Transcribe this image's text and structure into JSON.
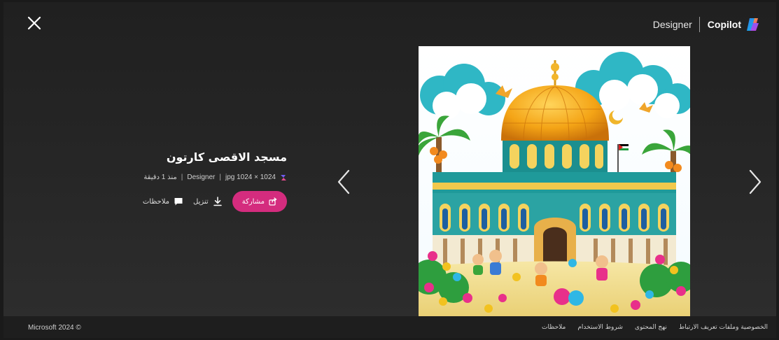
{
  "header": {
    "close_icon": "close-icon",
    "designer_label": "Designer",
    "copilot_label": "Copilot"
  },
  "image_info": {
    "title": "مسجد الاقصى كارتون",
    "file_info": "jpg 1024 × 1024",
    "source": "Designer",
    "time": "منذ 1 دقيقة",
    "share_label": "مشاركة",
    "download_label": "تنزيل",
    "feedback_label": "ملاحظات"
  },
  "navigation": {
    "prev_icon": "chevron-left-icon",
    "next_icon": "chevron-right-icon"
  },
  "footer": {
    "copyright": "Microsoft 2024 ©",
    "links": [
      "الخصوصية وملفات تعريف الارتباط",
      "نهج المحتوى",
      "شروط الاستخدام",
      "ملاحظات"
    ]
  },
  "colors": {
    "share_button": "#d42c7e",
    "background": "#262626"
  }
}
